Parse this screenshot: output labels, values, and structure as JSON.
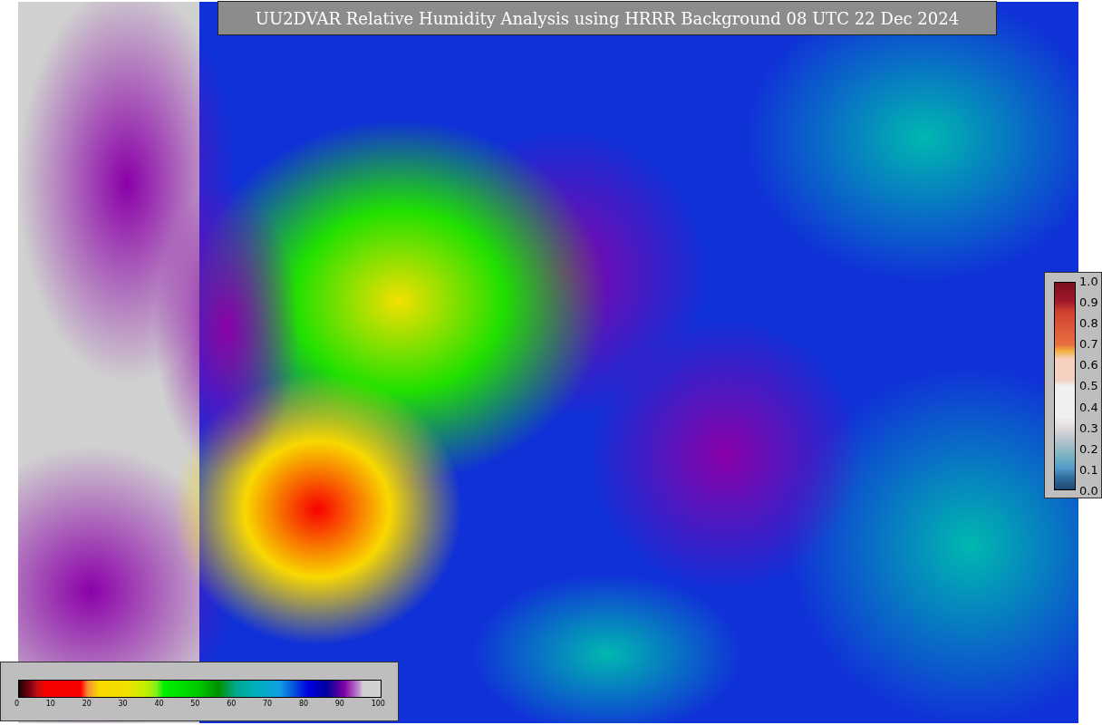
{
  "title": "UU2DVAR Relative Humidity Analysis using HRRR Background 08 UTC 22 Dec 2024",
  "humidity_colorbar": {
    "tick_labels": [
      "0",
      "10",
      "20",
      "30",
      "40",
      "50",
      "60",
      "70",
      "80",
      "90",
      "100"
    ]
  },
  "observation_colorbar": {
    "tick_labels": [
      "1.0",
      "0.9",
      "0.8",
      "0.7",
      "0.6",
      "0.5",
      "0.4",
      "0.3",
      "0.2",
      "0.1",
      "0.0"
    ]
  }
}
